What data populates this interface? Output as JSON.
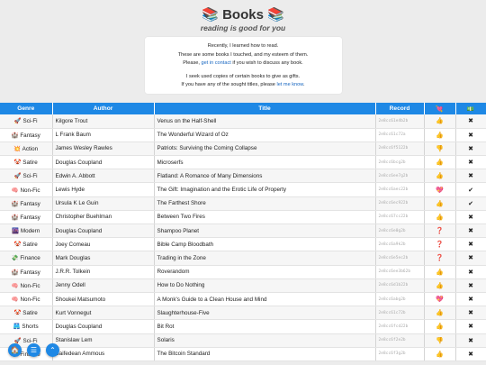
{
  "header": {
    "title": "📚 Books 📚",
    "tagline": "reading is good for you"
  },
  "intro": {
    "line1": "Recently, I learned how to read.",
    "line2": "These are some books I touched, and my esteem of them.",
    "line3_before": "Please, ",
    "contact_link": "get in contact",
    "line3_after": " if you wish to discuss any book.",
    "line4": "I seek used copies of certain books to give as gifts.",
    "line5_before": "If you have any of the sought titles, please ",
    "let_me_know_link": "let me know",
    "line5_after": "."
  },
  "table": {
    "headers": [
      "Genre",
      "Author",
      "Title",
      "Record",
      "💘",
      "💵"
    ],
    "rows": [
      {
        "genre": "🚀 Sci-Fi",
        "author": "Kilgore Trout",
        "title": "Venus on the Half-Shell",
        "record": "2e8cc61e4b2b",
        "heart": "👍",
        "money": "✖"
      },
      {
        "genre": "🏰 Fantasy",
        "author": "L Frank Baum",
        "title": "The Wonderful Wizard of Oz",
        "record": "2e8cc61c72a",
        "heart": "👍",
        "money": "✖"
      },
      {
        "genre": "💥 Action",
        "author": "James Wesley Rawles",
        "title": "Patriots: Surviving the Coming Collapse",
        "record": "2e8cc6f5122b",
        "heart": "👎",
        "money": "✖"
      },
      {
        "genre": "🤡 Satire",
        "author": "Douglas Coupland",
        "title": "Microserfs",
        "record": "2e8cc6bcg2b",
        "heart": "👍",
        "money": "✖"
      },
      {
        "genre": "🚀 Sci-Fi",
        "author": "Edwin A. Abbott",
        "title": "Flatland: A Romance of Many Dimensions",
        "record": "2e8cc6ee7g2b",
        "heart": "👍",
        "money": "✖"
      },
      {
        "genre": "🧠 Non-Fic",
        "author": "Lewis Hyde",
        "title": "The Gift: Imagination and the Erotic Life of Property",
        "record": "2e8cc6aec22b",
        "heart": "💖",
        "money": "✔"
      },
      {
        "genre": "🏰 Fantasy",
        "author": "Ursula K Le Guin",
        "title": "The Farthest Shore",
        "record": "2e8cc6ec922b",
        "heart": "👍",
        "money": "✔"
      },
      {
        "genre": "🏰 Fantasy",
        "author": "Christopher Buehlman",
        "title": "Between Two Fires",
        "record": "2e8cc67cc22b",
        "heart": "👍",
        "money": "✖"
      },
      {
        "genre": "🌆 Modern",
        "author": "Douglas Coupland",
        "title": "Shampoo Planet",
        "record": "2e8cc6e0g2b",
        "heart": "❓",
        "money": "✖"
      },
      {
        "genre": "🤡 Satire",
        "author": "Joey Comeau",
        "title": "Bible Camp Bloodbath",
        "record": "2e8cc6a9k2b",
        "heart": "❓",
        "money": "✖"
      },
      {
        "genre": "💸 Finance",
        "author": "Mark Douglas",
        "title": "Trading in the Zone",
        "record": "2e8cc6e5ec2b",
        "heart": "❓",
        "money": "✖"
      },
      {
        "genre": "🏰 Fantasy",
        "author": "J.R.R. Tolkein",
        "title": "Roverandom",
        "record": "2e8cc6ee3b62b",
        "heart": "👍",
        "money": "✖"
      },
      {
        "genre": "🧠 Non-Fic",
        "author": "Jenny Odell",
        "title": "How to Do Nothing",
        "record": "2e8cc6d1b22b",
        "heart": "👍",
        "money": "✖"
      },
      {
        "genre": "🧠 Non-Fic",
        "author": "Shoukei Matsumoto",
        "title": "A Monk's Guide to a Clean House and Mind",
        "record": "2e8cc6abg2b",
        "heart": "💖",
        "money": "✖"
      },
      {
        "genre": "🤡 Satire",
        "author": "Kurt Vonnegut",
        "title": "Slaughterhouse-Five",
        "record": "2e8cc61c72b",
        "heart": "👍",
        "money": "✖"
      },
      {
        "genre": "🩳 Shorts",
        "author": "Douglas Coupland",
        "title": "Bit Rot",
        "record": "2e8cc6fcd22b",
        "heart": "👍",
        "money": "✖"
      },
      {
        "genre": "🚀 Sci-Fi",
        "author": "Stanislaw Lem",
        "title": "Solaris",
        "record": "2e8cc6f2e2b",
        "heart": "👎",
        "money": "✖"
      },
      {
        "genre": "💸 Finance",
        "author": "Saifedean Ammous",
        "title": "The Bitcoin Standard",
        "record": "2e8cc6f3g2b",
        "heart": "👍",
        "money": "✖"
      }
    ]
  },
  "fabs": {
    "home_icon": "🏠",
    "menu_icon": "☰",
    "up_icon": "⌃"
  },
  "colors": {
    "accent": "#1e88e5",
    "link": "#1565c0"
  }
}
